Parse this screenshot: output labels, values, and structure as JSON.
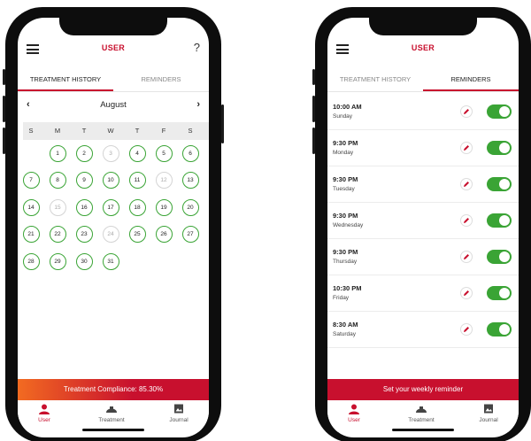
{
  "left_screen": {
    "title": "USER",
    "help_label": "?",
    "tabs": [
      {
        "label": "TREATMENT HISTORY",
        "active": true
      },
      {
        "label": "REMINDERS",
        "active": false
      }
    ],
    "calendar": {
      "month": "August",
      "prev_label": "‹",
      "next_label": "›",
      "weekdays": [
        "S",
        "M",
        "T",
        "W",
        "T",
        "F",
        "S"
      ],
      "first_weekday_index": 1,
      "days": [
        {
          "label": "1",
          "status": "completed"
        },
        {
          "label": "2",
          "status": "completed"
        },
        {
          "label": "3",
          "status": "missed"
        },
        {
          "label": "4",
          "status": "completed"
        },
        {
          "label": "5",
          "status": "completed"
        },
        {
          "label": "6",
          "status": "completed"
        },
        {
          "label": "7",
          "status": "completed"
        },
        {
          "label": "8",
          "status": "completed"
        },
        {
          "label": "9",
          "status": "completed"
        },
        {
          "label": "10",
          "status": "completed"
        },
        {
          "label": "11",
          "status": "completed"
        },
        {
          "label": "12",
          "status": "missed"
        },
        {
          "label": "13",
          "status": "completed"
        },
        {
          "label": "14",
          "status": "completed"
        },
        {
          "label": "15",
          "status": "missed"
        },
        {
          "label": "16",
          "status": "completed"
        },
        {
          "label": "17",
          "status": "completed"
        },
        {
          "label": "18",
          "status": "completed"
        },
        {
          "label": "19",
          "status": "completed"
        },
        {
          "label": "20",
          "status": "completed"
        },
        {
          "label": "21",
          "status": "completed"
        },
        {
          "label": "22",
          "status": "completed"
        },
        {
          "label": "23",
          "status": "completed"
        },
        {
          "label": "24",
          "status": "missed"
        },
        {
          "label": "25",
          "status": "completed"
        },
        {
          "label": "26",
          "status": "completed"
        },
        {
          "label": "27",
          "status": "completed"
        },
        {
          "label": "28",
          "status": "completed"
        },
        {
          "label": "29",
          "status": "completed"
        },
        {
          "label": "30",
          "status": "completed"
        },
        {
          "label": "31",
          "status": "completed"
        }
      ]
    },
    "banner": "Treatment Compliance: 85.30%",
    "nav": [
      {
        "label": "User",
        "icon": "user-icon",
        "active": true
      },
      {
        "label": "Treatment",
        "icon": "treatment-icon",
        "active": false
      },
      {
        "label": "Journal",
        "icon": "journal-icon",
        "active": false
      }
    ]
  },
  "right_screen": {
    "title": "USER",
    "tabs": [
      {
        "label": "TREATMENT HISTORY",
        "active": false
      },
      {
        "label": "REMINDERS",
        "active": true
      }
    ],
    "reminders": [
      {
        "time": "10:00 AM",
        "day": "Sunday",
        "enabled": true
      },
      {
        "time": "9:30 PM",
        "day": "Monday",
        "enabled": true
      },
      {
        "time": "9:30 PM",
        "day": "Tuesday",
        "enabled": true
      },
      {
        "time": "9:30 PM",
        "day": "Wednesday",
        "enabled": true
      },
      {
        "time": "9:30 PM",
        "day": "Thursday",
        "enabled": true
      },
      {
        "time": "10:30 PM",
        "day": "Friday",
        "enabled": true
      },
      {
        "time": "8:30 AM",
        "day": "Saturday",
        "enabled": true
      }
    ],
    "banner": "Set your weekly reminder",
    "nav": [
      {
        "label": "User",
        "icon": "user-icon",
        "active": true
      },
      {
        "label": "Treatment",
        "icon": "treatment-icon",
        "active": false
      },
      {
        "label": "Journal",
        "icon": "journal-icon",
        "active": false
      }
    ]
  },
  "colors": {
    "brand_red": "#c8102e",
    "brand_orange": "#f26b21",
    "completed_green": "#3aa435",
    "missed_gray": "#d4d4d4"
  }
}
